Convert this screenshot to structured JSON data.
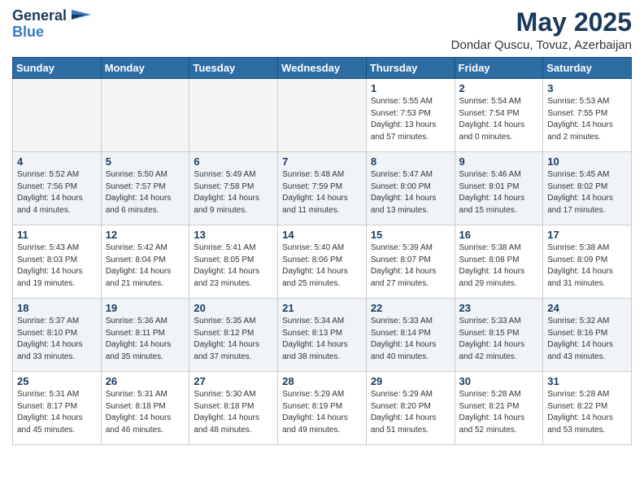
{
  "logo": {
    "general": "General",
    "blue": "Blue"
  },
  "title": "May 2025",
  "subtitle": "Dondar Quscu, Tovuz, Azerbaijan",
  "days": [
    "Sunday",
    "Monday",
    "Tuesday",
    "Wednesday",
    "Thursday",
    "Friday",
    "Saturday"
  ],
  "weeks": [
    [
      {
        "num": "",
        "info": "",
        "empty": true
      },
      {
        "num": "",
        "info": "",
        "empty": true
      },
      {
        "num": "",
        "info": "",
        "empty": true
      },
      {
        "num": "",
        "info": "",
        "empty": true
      },
      {
        "num": "1",
        "info": "Sunrise: 5:55 AM\nSunset: 7:53 PM\nDaylight: 13 hours\nand 57 minutes."
      },
      {
        "num": "2",
        "info": "Sunrise: 5:54 AM\nSunset: 7:54 PM\nDaylight: 14 hours\nand 0 minutes."
      },
      {
        "num": "3",
        "info": "Sunrise: 5:53 AM\nSunset: 7:55 PM\nDaylight: 14 hours\nand 2 minutes."
      }
    ],
    [
      {
        "num": "4",
        "info": "Sunrise: 5:52 AM\nSunset: 7:56 PM\nDaylight: 14 hours\nand 4 minutes."
      },
      {
        "num": "5",
        "info": "Sunrise: 5:50 AM\nSunset: 7:57 PM\nDaylight: 14 hours\nand 6 minutes."
      },
      {
        "num": "6",
        "info": "Sunrise: 5:49 AM\nSunset: 7:58 PM\nDaylight: 14 hours\nand 9 minutes."
      },
      {
        "num": "7",
        "info": "Sunrise: 5:48 AM\nSunset: 7:59 PM\nDaylight: 14 hours\nand 11 minutes."
      },
      {
        "num": "8",
        "info": "Sunrise: 5:47 AM\nSunset: 8:00 PM\nDaylight: 14 hours\nand 13 minutes."
      },
      {
        "num": "9",
        "info": "Sunrise: 5:46 AM\nSunset: 8:01 PM\nDaylight: 14 hours\nand 15 minutes."
      },
      {
        "num": "10",
        "info": "Sunrise: 5:45 AM\nSunset: 8:02 PM\nDaylight: 14 hours\nand 17 minutes."
      }
    ],
    [
      {
        "num": "11",
        "info": "Sunrise: 5:43 AM\nSunset: 8:03 PM\nDaylight: 14 hours\nand 19 minutes."
      },
      {
        "num": "12",
        "info": "Sunrise: 5:42 AM\nSunset: 8:04 PM\nDaylight: 14 hours\nand 21 minutes."
      },
      {
        "num": "13",
        "info": "Sunrise: 5:41 AM\nSunset: 8:05 PM\nDaylight: 14 hours\nand 23 minutes."
      },
      {
        "num": "14",
        "info": "Sunrise: 5:40 AM\nSunset: 8:06 PM\nDaylight: 14 hours\nand 25 minutes."
      },
      {
        "num": "15",
        "info": "Sunrise: 5:39 AM\nSunset: 8:07 PM\nDaylight: 14 hours\nand 27 minutes."
      },
      {
        "num": "16",
        "info": "Sunrise: 5:38 AM\nSunset: 8:08 PM\nDaylight: 14 hours\nand 29 minutes."
      },
      {
        "num": "17",
        "info": "Sunrise: 5:38 AM\nSunset: 8:09 PM\nDaylight: 14 hours\nand 31 minutes."
      }
    ],
    [
      {
        "num": "18",
        "info": "Sunrise: 5:37 AM\nSunset: 8:10 PM\nDaylight: 14 hours\nand 33 minutes."
      },
      {
        "num": "19",
        "info": "Sunrise: 5:36 AM\nSunset: 8:11 PM\nDaylight: 14 hours\nand 35 minutes."
      },
      {
        "num": "20",
        "info": "Sunrise: 5:35 AM\nSunset: 8:12 PM\nDaylight: 14 hours\nand 37 minutes."
      },
      {
        "num": "21",
        "info": "Sunrise: 5:34 AM\nSunset: 8:13 PM\nDaylight: 14 hours\nand 38 minutes."
      },
      {
        "num": "22",
        "info": "Sunrise: 5:33 AM\nSunset: 8:14 PM\nDaylight: 14 hours\nand 40 minutes."
      },
      {
        "num": "23",
        "info": "Sunrise: 5:33 AM\nSunset: 8:15 PM\nDaylight: 14 hours\nand 42 minutes."
      },
      {
        "num": "24",
        "info": "Sunrise: 5:32 AM\nSunset: 8:16 PM\nDaylight: 14 hours\nand 43 minutes."
      }
    ],
    [
      {
        "num": "25",
        "info": "Sunrise: 5:31 AM\nSunset: 8:17 PM\nDaylight: 14 hours\nand 45 minutes."
      },
      {
        "num": "26",
        "info": "Sunrise: 5:31 AM\nSunset: 8:18 PM\nDaylight: 14 hours\nand 46 minutes."
      },
      {
        "num": "27",
        "info": "Sunrise: 5:30 AM\nSunset: 8:18 PM\nDaylight: 14 hours\nand 48 minutes."
      },
      {
        "num": "28",
        "info": "Sunrise: 5:29 AM\nSunset: 8:19 PM\nDaylight: 14 hours\nand 49 minutes."
      },
      {
        "num": "29",
        "info": "Sunrise: 5:29 AM\nSunset: 8:20 PM\nDaylight: 14 hours\nand 51 minutes."
      },
      {
        "num": "30",
        "info": "Sunrise: 5:28 AM\nSunset: 8:21 PM\nDaylight: 14 hours\nand 52 minutes."
      },
      {
        "num": "31",
        "info": "Sunrise: 5:28 AM\nSunset: 8:22 PM\nDaylight: 14 hours\nand 53 minutes."
      }
    ]
  ]
}
